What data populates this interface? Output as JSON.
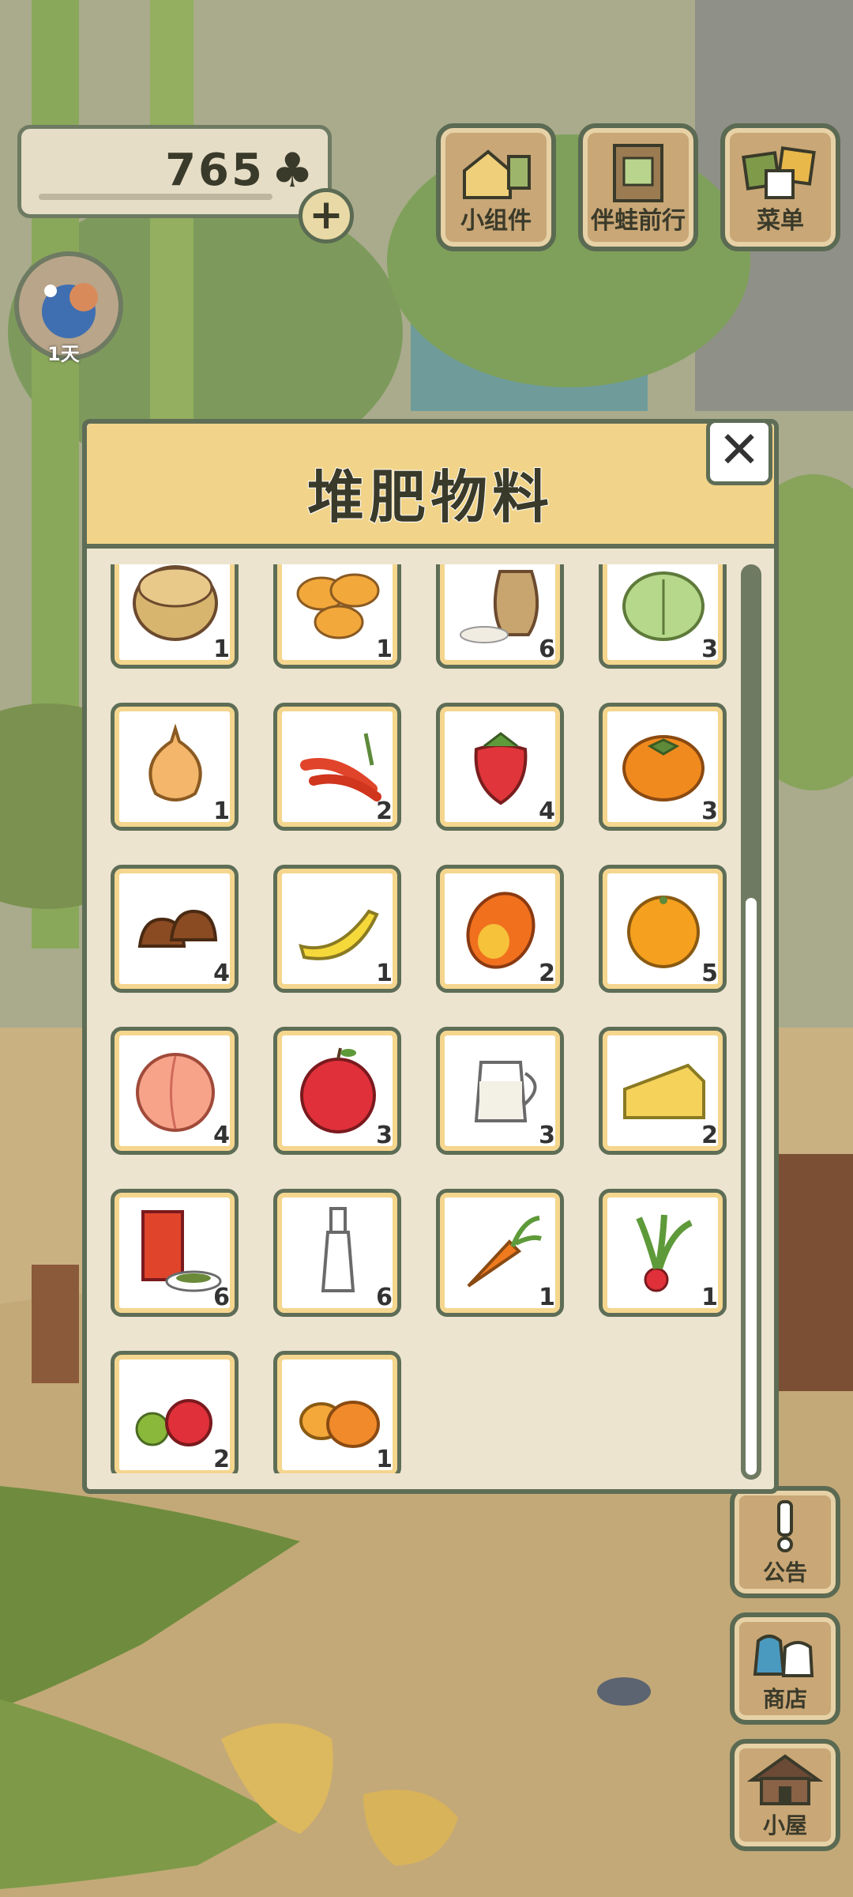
{
  "currency": {
    "value": "765",
    "symbol": "♣"
  },
  "avatar": {
    "day_label": "1天"
  },
  "top_buttons": [
    {
      "label": "小组件",
      "icon": "widget-icon"
    },
    {
      "label": "伴蛙前行",
      "icon": "frog-companion-icon"
    },
    {
      "label": "菜单",
      "icon": "menu-icon"
    }
  ],
  "side_buttons": [
    {
      "label": "公告",
      "icon": "exclamation-icon"
    },
    {
      "label": "商店",
      "icon": "shop-bag-icon"
    },
    {
      "label": "小屋",
      "icon": "house-icon"
    }
  ],
  "dialog": {
    "title": "堆肥物料",
    "close_symbol": "✕",
    "items": [
      {
        "icon": "nuts-basket-icon",
        "qty": "1"
      },
      {
        "icon": "egg-tarts-icon",
        "qty": "1"
      },
      {
        "icon": "rice-sack-icon",
        "qty": "6"
      },
      {
        "icon": "cabbage-icon",
        "qty": "3"
      },
      {
        "icon": "onion-icon",
        "qty": "1"
      },
      {
        "icon": "chili-peppers-icon",
        "qty": "2"
      },
      {
        "icon": "strawberry-icon",
        "qty": "4"
      },
      {
        "icon": "persimmon-icon",
        "qty": "3"
      },
      {
        "icon": "chestnuts-icon",
        "qty": "4"
      },
      {
        "icon": "banana-icon",
        "qty": "1"
      },
      {
        "icon": "mango-icon",
        "qty": "2"
      },
      {
        "icon": "orange-icon",
        "qty": "5"
      },
      {
        "icon": "peach-icon",
        "qty": "4"
      },
      {
        "icon": "apple-icon",
        "qty": "3"
      },
      {
        "icon": "milk-jug-icon",
        "qty": "3"
      },
      {
        "icon": "cheese-icon",
        "qty": "2"
      },
      {
        "icon": "tea-can-icon",
        "qty": "6"
      },
      {
        "icon": "glass-bottle-icon",
        "qty": "6"
      },
      {
        "icon": "carrot-icon",
        "qty": "1"
      },
      {
        "icon": "radish-icon",
        "qty": "1"
      },
      {
        "icon": "tomatoes-icon",
        "qty": "2"
      },
      {
        "icon": "pumpkins-icon",
        "qty": "1"
      }
    ]
  },
  "colors": {
    "dialog_header": "#f1d489",
    "dialog_body": "#ece4cf",
    "border": "#5e6d56",
    "card_inner": "#f5d68e"
  }
}
